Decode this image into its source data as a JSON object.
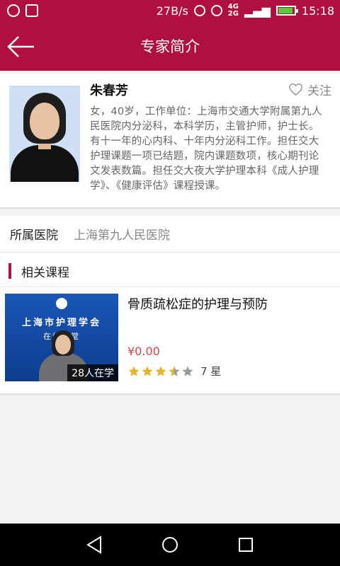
{
  "status_bar": {
    "speed": "27B/s",
    "network_top": "4G",
    "network_bottom": "2G",
    "time": "15:18",
    "battery_level": 0.9
  },
  "app_bar": {
    "title": "专家简介"
  },
  "expert": {
    "name": "朱春芳",
    "follow_label": "关注",
    "bio": "女，40岁，工作单位：上海市交通大学附属第九人民医院内分泌科，本科学历，主管护师，护士长。有十一年的心内科、十年内分泌科工作。担任交大护理课题一项已结题，院内课题数项，核心期刊论文发表数篇。担任交大夜大学护理本科《成人护理学》、《健康评估》课程授课。"
  },
  "hospital": {
    "label": "所属医院",
    "value": "上海第九人民医院"
  },
  "courses_section": {
    "title": "相关课程",
    "items": [
      {
        "title": "骨质疏松症的护理与预防",
        "price": "¥0.00",
        "rating": 3.5,
        "rating_max": 5,
        "rating_label": "7 星",
        "learners": "28人在学",
        "thumb_banner": "上海市护理学会",
        "thumb_banner2": "在线课堂"
      }
    ]
  },
  "colors": {
    "brand": "#b0103f",
    "price": "#e0444c",
    "star": "#e6b42a",
    "star_empty": "#9a9a9a"
  },
  "icons": [
    "back-arrow-icon",
    "heart-icon",
    "star-icon",
    "nav-back-icon",
    "nav-home-icon",
    "nav-recents-icon"
  ]
}
